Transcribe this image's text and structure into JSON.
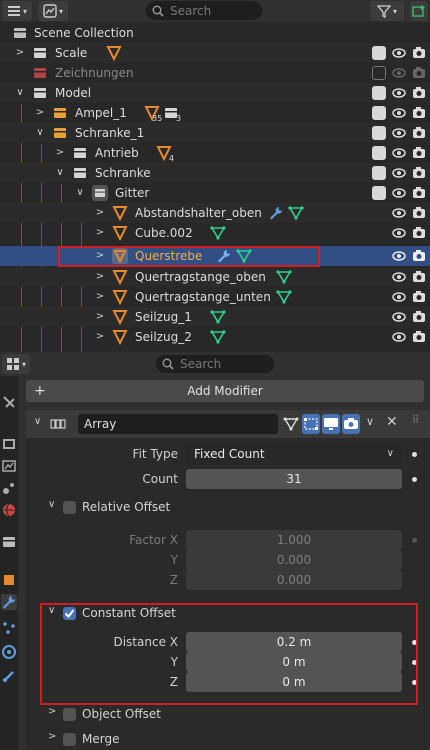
{
  "outliner": {
    "search_placeholder": "Search",
    "rows": [
      {
        "label": "Scene Collection"
      },
      {
        "label": "Scale"
      },
      {
        "label": "Zeichnungen"
      },
      {
        "label": "Model"
      },
      {
        "label": "Ampel_1",
        "sub1": "35",
        "sub2": "3"
      },
      {
        "label": "Schranke_1"
      },
      {
        "label": "Antrieb",
        "sub1": "4"
      },
      {
        "label": "Schranke"
      },
      {
        "label": "Gitter"
      },
      {
        "label": "Abstandshalter_oben"
      },
      {
        "label": "Cube.002"
      },
      {
        "label": "Querstrebe"
      },
      {
        "label": "Quertragstange_oben"
      },
      {
        "label": "Quertragstange_unten"
      },
      {
        "label": "Seilzug_1"
      },
      {
        "label": "Seilzug_2"
      }
    ]
  },
  "properties": {
    "search_placeholder": "Search",
    "add_modifier": "Add Modifier",
    "modifier": {
      "name": "Array",
      "fit_type": {
        "label": "Fit Type",
        "value": "Fixed Count"
      },
      "count": {
        "label": "Count",
        "value": "31"
      },
      "relative_offset": {
        "label": "Relative Offset",
        "factor_x": {
          "label": "Factor X",
          "value": "1.000"
        },
        "y": {
          "label": "Y",
          "value": "0.000"
        },
        "z": {
          "label": "Z",
          "value": "0.000"
        }
      },
      "constant_offset": {
        "label": "Constant Offset",
        "distance_x": {
          "label": "Distance X",
          "value": "0.2 m"
        },
        "y": {
          "label": "Y",
          "value": "0 m"
        },
        "z": {
          "label": "Z",
          "value": "0 m"
        }
      },
      "object_offset": {
        "label": "Object Offset"
      },
      "merge": {
        "label": "Merge"
      }
    }
  },
  "colors": {
    "selection": "#324f85",
    "accent_blue": "#4772b3",
    "highlight_red": "#d11c20",
    "collection_icon": "#cfcfcf",
    "mesh_orange": "#e6892e",
    "data_green": "#2fcf8e",
    "modifier_blue": "#5f9ee0"
  }
}
